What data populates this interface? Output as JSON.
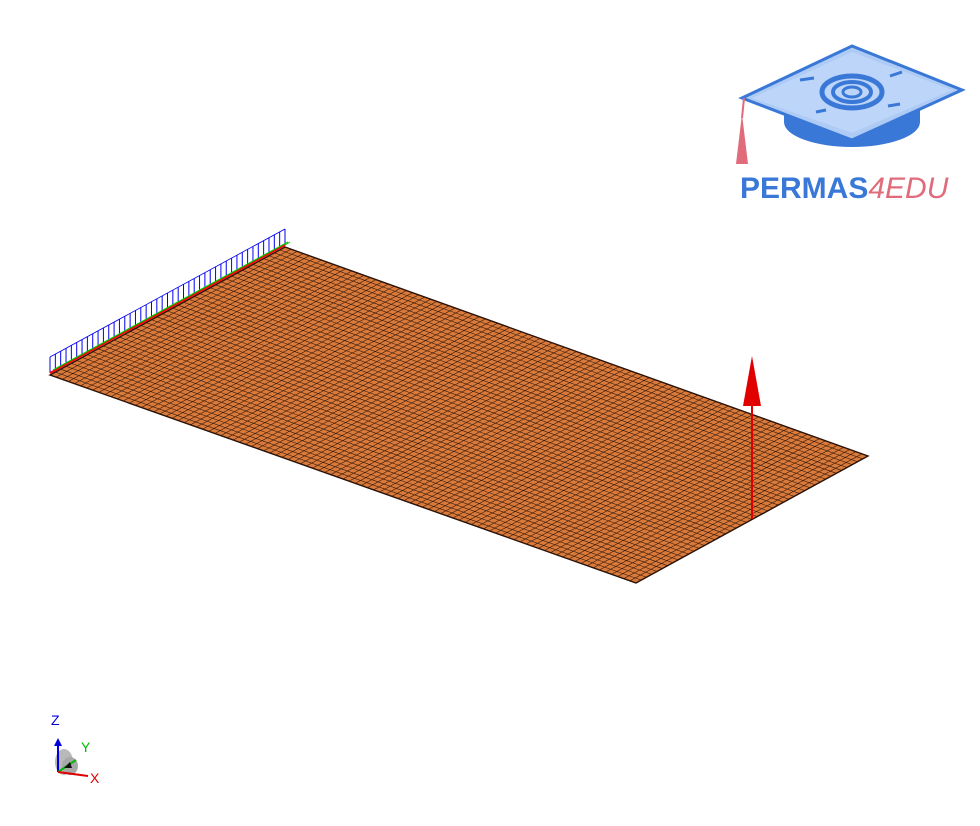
{
  "logo": {
    "brand": "PERMAS",
    "suffix": "4EDU"
  },
  "triad": {
    "z_label": "Z",
    "y_label": "Y",
    "x_label": "X"
  },
  "colors": {
    "plate_fill": "#d97a3a",
    "mesh_line": "#2a1208",
    "force_arrow": "#e00000",
    "constraint_blue": "#0000ee",
    "constraint_green": "#00cc00",
    "constraint_red": "#ff0000",
    "axis_x": "#e00000",
    "axis_y": "#00bb00",
    "axis_z": "#0000dd",
    "logo_blue": "#3a78d8",
    "logo_pink": "#e06b7b"
  },
  "icons": {
    "logo": "graduation-cap-icon",
    "load": "force-arrow-icon",
    "support": "fixed-support-icon",
    "triad": "coordinate-triad-icon"
  }
}
